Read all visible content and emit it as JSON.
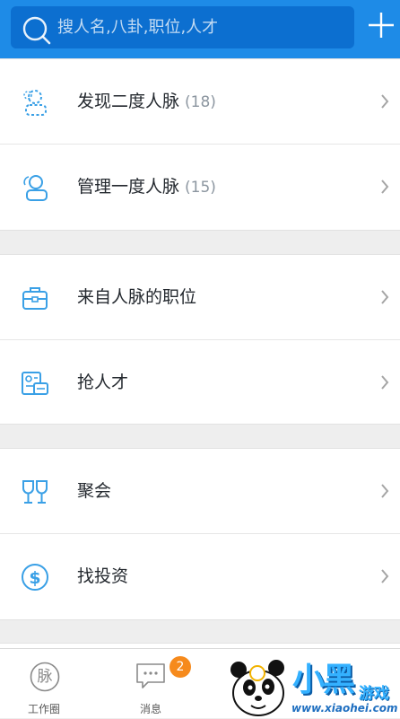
{
  "search": {
    "placeholder": "搜人名,八卦,职位,人才"
  },
  "menu": {
    "group1": [
      {
        "label": "发现二度人脉",
        "count": "(18)",
        "icon": "second-degree-contacts-icon"
      },
      {
        "label": "管理一度人脉",
        "count": "(15)",
        "icon": "first-degree-contacts-icon"
      }
    ],
    "group2": [
      {
        "label": "来自人脉的职位",
        "icon": "briefcase-icon"
      },
      {
        "label": "抢人才",
        "icon": "resume-card-icon"
      }
    ],
    "group3": [
      {
        "label": "聚会",
        "icon": "wine-glasses-icon"
      },
      {
        "label": "找投资",
        "icon": "dollar-coin-icon"
      }
    ]
  },
  "tabbar": {
    "tabs": [
      {
        "label": "工作圈",
        "icon_text": "脉",
        "icon": "mai-logo-icon"
      },
      {
        "label": "消息",
        "icon": "chat-bubble-icon",
        "badge": "2"
      }
    ]
  },
  "watermark": {
    "main": "小黑",
    "game": "游戏",
    "url": "www.xiaohei.com"
  },
  "colors": {
    "header": "#1e8be7",
    "search_bg": "#0c6fd0",
    "icon_blue": "#3aa0e6",
    "badge": "#f68a1c"
  }
}
